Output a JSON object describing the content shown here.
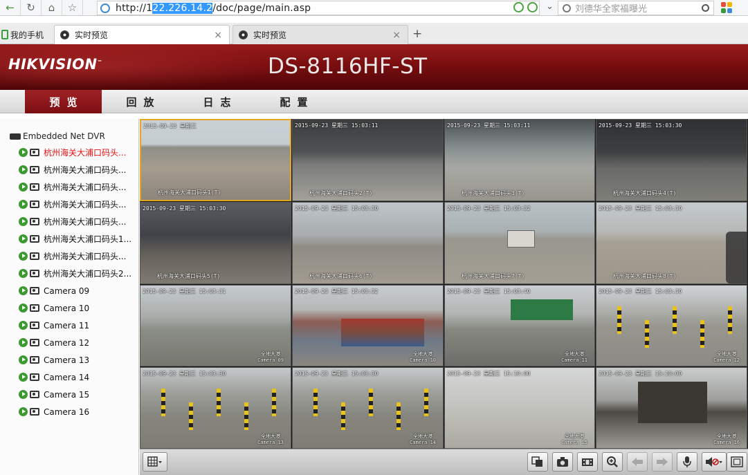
{
  "browser": {
    "url_prefix": "http://1",
    "url_selected": "22.226.14.2",
    "url_suffix": "/doc/page/main.asp",
    "search_placeholder": "刘德华全家福曝光",
    "tabs": [
      {
        "label": "我的手机"
      },
      {
        "label": "实时预览",
        "close": "×"
      },
      {
        "label": "实时预览",
        "close": "×"
      }
    ],
    "new_tab": "+"
  },
  "header": {
    "logo": "HIKVISION",
    "logo_tm": "™",
    "model": "DS-8116HF-ST"
  },
  "menu": {
    "items": [
      {
        "label": "预览",
        "active": true
      },
      {
        "label": "回放"
      },
      {
        "label": "日志"
      },
      {
        "label": "配置"
      }
    ]
  },
  "tree": {
    "root": "Embedded Net DVR",
    "items": [
      {
        "label": "杭州海关大浦口码头...",
        "selected": true
      },
      {
        "label": "杭州海关大浦口码头..."
      },
      {
        "label": "杭州海关大浦口码头..."
      },
      {
        "label": "杭州海关大浦口码头..."
      },
      {
        "label": "杭州海关大浦口码头..."
      },
      {
        "label": "杭州海关大浦口码头1..."
      },
      {
        "label": "杭州海关大浦口码头..."
      },
      {
        "label": "杭州海关大浦口码头2..."
      },
      {
        "label": "Camera 09"
      },
      {
        "label": "Camera 10"
      },
      {
        "label": "Camera 11"
      },
      {
        "label": "Camera 12"
      },
      {
        "label": "Camera 13"
      },
      {
        "label": "Camera 14"
      },
      {
        "label": "Camera 15"
      },
      {
        "label": "Camera 16"
      }
    ]
  },
  "tiles": [
    {
      "time": "2015-09-23 星期三",
      "name": "杭州海关大浦口码头1(T)",
      "cam": ""
    },
    {
      "time": "2015-09-23 星期三 15:03:11",
      "name": "杭州海关大浦口码头2(T)",
      "cam": ""
    },
    {
      "time": "2015-09-23 星期三 15:03:11",
      "name": "杭州海关大浦口码头3(T)",
      "cam": ""
    },
    {
      "time": "2015-09-23 星期三 15:03:30",
      "name": "杭州海关大浦口码头4(T)",
      "cam": ""
    },
    {
      "time": "2015-09-23 星期三 15:03:30",
      "name": "杭州海关大浦口码头5(T)",
      "cam": ""
    },
    {
      "time": "2015-09-23 星期三 15:03:30",
      "name": "杭州海关大浦口码头6(T)",
      "cam": ""
    },
    {
      "time": "2015-09-23 星期三 15:03:32",
      "name": "杭州海关大浦口码头7(T)",
      "cam": ""
    },
    {
      "time": "2015-09-23 星期三 15:03:30",
      "name": "杭州海关大浦口码头8(T)",
      "cam": ""
    },
    {
      "time": "2015-09-23 星期三 15:03:31",
      "name": "",
      "cam": "全地大港\nCamera 09"
    },
    {
      "time": "2015-09-23 星期三 15:03:32",
      "name": "",
      "cam": "全地大港\nCamera 10"
    },
    {
      "time": "2015-09-23 星期三 15:03:40",
      "name": "",
      "cam": "全地大港\nCamera 11"
    },
    {
      "time": "2015-09-23 星期三 15:03:30",
      "name": "",
      "cam": "全地大港\nCamera 12"
    },
    {
      "time": "2015-09-23 星期三 15:03:30",
      "name": "",
      "cam": "全地大港\nCamera 13"
    },
    {
      "time": "2015-09-23 星期三 15:03:30",
      "name": "",
      "cam": "全地大港\nCamera 14"
    },
    {
      "time": "2015-09-23 星期三 15:10:00",
      "name": "",
      "cam": "全地大港\nCamera 15"
    },
    {
      "time": "2015-09-23 星期三 15:10:00",
      "name": "",
      "cam": "全地大港\nCamera 16"
    }
  ],
  "toolbar": {
    "icons": [
      "grid-layout-icon",
      "stop-all-icon",
      "capture-icon",
      "record-icon",
      "zoom-icon",
      "prev-page-icon",
      "next-page-icon",
      "microphone-icon",
      "volume-mute-icon",
      "fullscreen-icon"
    ]
  },
  "colors": {
    "brand_red": "#7c0f13",
    "selected_tree": "#e01010",
    "tile_selected_border": "#e3a620",
    "play_green": "#3b9a2f"
  }
}
